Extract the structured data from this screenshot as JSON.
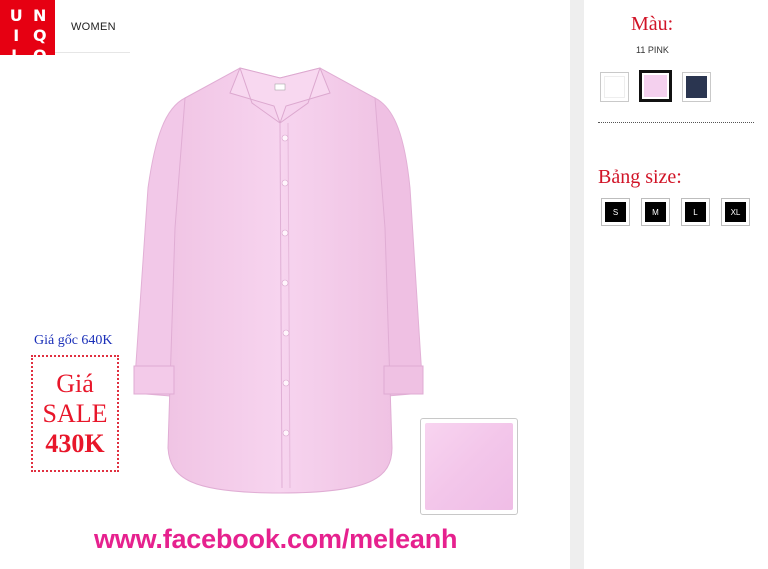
{
  "brand": {
    "logo_letters": [
      "U",
      "N",
      "I",
      "Q",
      "L",
      "O"
    ],
    "color": "#e60012"
  },
  "category": "WOMEN",
  "price": {
    "original": "Giá gốc 640K",
    "sale_line1": "Giá",
    "sale_line2": "SALE",
    "sale_line3": "430K"
  },
  "product": {
    "image_icon": "pink-shirt-image",
    "fabric_icon": "fabric-swatch"
  },
  "footer": {
    "url": "www.facebook.com/meleanh"
  },
  "color_panel": {
    "heading": "Màu:",
    "selected_name": "11 PINK",
    "options": [
      {
        "name": "white",
        "hex": "#ffffff"
      },
      {
        "name": "pink",
        "hex": "#f4d0ee",
        "selected": true
      },
      {
        "name": "navy",
        "hex": "#2a3550"
      }
    ]
  },
  "size_panel": {
    "heading": "Bảng size:",
    "sizes": [
      "S",
      "M",
      "L",
      "XL"
    ]
  }
}
